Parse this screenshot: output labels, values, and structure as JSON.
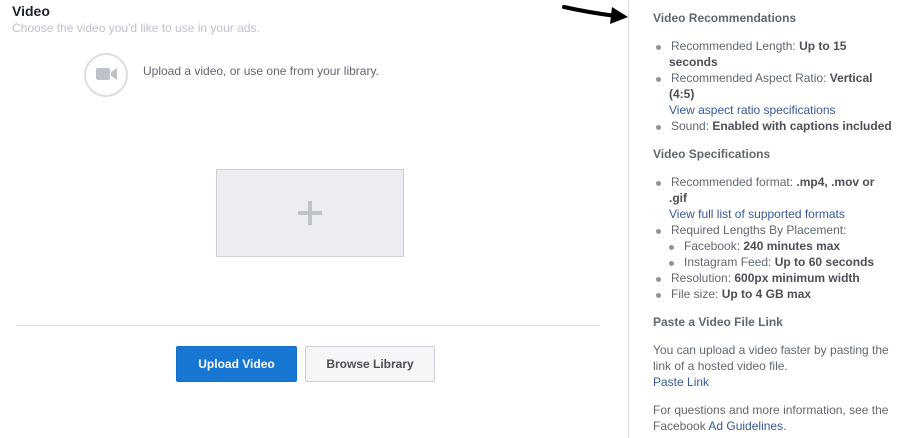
{
  "video": {
    "title": "Video",
    "subtitle": "Choose the video you'd like to use in your ads.",
    "upload_hint": "Upload a video, or use one from your library.",
    "camera_icon": "video-camera-icon",
    "add_icon": "plus-icon",
    "buttons": {
      "upload": "Upload Video",
      "browse": "Browse Library"
    }
  },
  "recommendations": {
    "title": "Video Recommendations",
    "length_label": "Recommended Length: ",
    "length_value_1": "Up to 15",
    "length_value_2": "seconds",
    "aspect_label": "Recommended Aspect Ratio: ",
    "aspect_value_1": "Vertical",
    "aspect_value_2": "(4:5)",
    "aspect_link": "View aspect ratio specifications",
    "sound_label": "Sound: ",
    "sound_value": "Enabled with captions included"
  },
  "specifications": {
    "title": "Video Specifications",
    "format_label": "Recommended format: ",
    "format_value_1": ".mp4, .mov or",
    "format_value_2": ".gif",
    "formats_link": "View full list of supported formats",
    "lengths_label": "Required Lengths By Placement:",
    "facebook_label": "Facebook: ",
    "facebook_value": "240 minutes max",
    "instagram_label": "Instagram Feed: ",
    "instagram_value": "Up to 60 seconds",
    "resolution_label": "Resolution: ",
    "resolution_value": "600px minimum width",
    "filesize_label": "File size: ",
    "filesize_value": "Up to 4 GB max"
  },
  "paste_link": {
    "title": "Paste a Video File Link",
    "text_1": "You can upload a video faster by pasting the",
    "text_2": "link of a hosted video file.",
    "link": "Paste Link"
  },
  "footer": {
    "text_1": "For questions and more information, see the",
    "text_2_prefix": "Facebook ",
    "guidelines_link": "Ad Guidelines",
    "text_2_suffix": "."
  },
  "annotation": {
    "arrow_icon": "arrow-pointer-icon"
  },
  "colors": {
    "primary_button": "#1877d2",
    "link": "#385898",
    "muted_text": "#606770"
  }
}
